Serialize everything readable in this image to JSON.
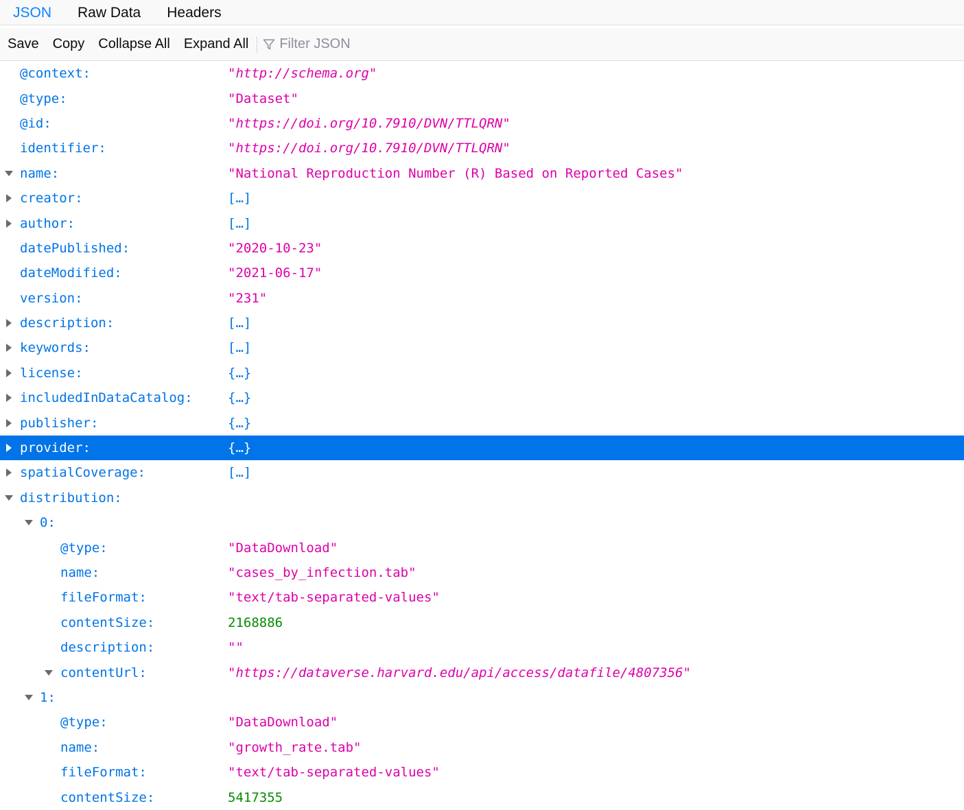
{
  "tabs": {
    "json": "JSON",
    "raw": "Raw Data",
    "headers": "Headers"
  },
  "toolbar": {
    "save": "Save",
    "copy": "Copy",
    "collapse": "Collapse All",
    "expand": "Expand All",
    "filter_placeholder": "Filter JSON"
  },
  "colors": {
    "accent": "#0a84ff",
    "key": "#0074e8",
    "string": "#dd00a9",
    "number": "#058b00",
    "selected_bg": "#0074e8"
  },
  "rows": [
    {
      "key": "@context:",
      "value": "\"http://schema.org\""
    },
    {
      "key": "@type:",
      "value": "\"Dataset\""
    },
    {
      "key": "@id:",
      "value": "\"https://doi.org/10.7910/DVN/TTLQRN\""
    },
    {
      "key": "identifier:",
      "value": "\"https://doi.org/10.7910/DVN/TTLQRN\""
    },
    {
      "key": "name:",
      "value": "\"National Reproduction Number (R) Based on Reported Cases\""
    },
    {
      "key": "creator:",
      "value": "[…]"
    },
    {
      "key": "author:",
      "value": "[…]"
    },
    {
      "key": "datePublished:",
      "value": "\"2020-10-23\""
    },
    {
      "key": "dateModified:",
      "value": "\"2021-06-17\""
    },
    {
      "key": "version:",
      "value": "\"231\""
    },
    {
      "key": "description:",
      "value": "[…]"
    },
    {
      "key": "keywords:",
      "value": "[…]"
    },
    {
      "key": "license:",
      "value": "{…}"
    },
    {
      "key": "includedInDataCatalog:",
      "value": "{…}"
    },
    {
      "key": "publisher:",
      "value": "{…}"
    },
    {
      "key": "provider:",
      "value": "{…}"
    },
    {
      "key": "spatialCoverage:",
      "value": "[…]"
    },
    {
      "key": "distribution:",
      "value": ""
    },
    {
      "key": "0:",
      "value": ""
    },
    {
      "key": "@type:",
      "value": "\"DataDownload\""
    },
    {
      "key": "name:",
      "value": "\"cases_by_infection.tab\""
    },
    {
      "key": "fileFormat:",
      "value": "\"text/tab-separated-values\""
    },
    {
      "key": "contentSize:",
      "value": "2168886"
    },
    {
      "key": "description:",
      "value": "\"\""
    },
    {
      "key": "contentUrl:",
      "value": "\"https://dataverse.harvard.edu/api/access/datafile/4807356\""
    },
    {
      "key": "1:",
      "value": ""
    },
    {
      "key": "@type:",
      "value": "\"DataDownload\""
    },
    {
      "key": "name:",
      "value": "\"growth_rate.tab\""
    },
    {
      "key": "fileFormat:",
      "value": "\"text/tab-separated-values\""
    },
    {
      "key": "contentSize:",
      "value": "5417355"
    }
  ]
}
